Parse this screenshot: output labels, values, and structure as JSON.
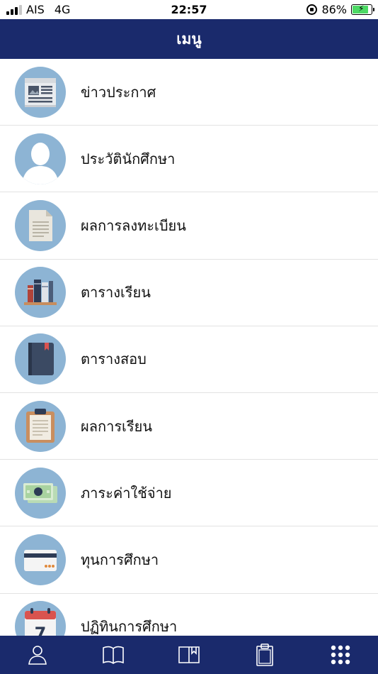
{
  "status_bar": {
    "carrier": "AIS",
    "network": "4G",
    "time": "22:57",
    "battery": "86%",
    "battery_level": 0.86
  },
  "header": {
    "title": "เมนู"
  },
  "menu": {
    "items": [
      {
        "label": "ข่าวประกาศ",
        "icon": "newspaper-icon"
      },
      {
        "label": "ประวัตินักศึกษา",
        "icon": "profile-icon"
      },
      {
        "label": "ผลการลงทะเบียน",
        "icon": "document-icon"
      },
      {
        "label": "ตารางเรียน",
        "icon": "books-icon"
      },
      {
        "label": "ตารางสอบ",
        "icon": "notebook-icon"
      },
      {
        "label": "ผลการเรียน",
        "icon": "clipboard-icon"
      },
      {
        "label": "ภาระค่าใช้จ่าย",
        "icon": "money-icon"
      },
      {
        "label": "ทุนการศึกษา",
        "icon": "card-icon"
      },
      {
        "label": "ปฏิทินการศึกษา",
        "icon": "calendar-icon"
      }
    ],
    "calendar_day": "7"
  },
  "tab_bar": {
    "tabs": [
      {
        "icon": "person-icon"
      },
      {
        "icon": "book-open-icon"
      },
      {
        "icon": "bookmark-book-icon"
      },
      {
        "icon": "clipboard-tab-icon"
      },
      {
        "icon": "grid-icon",
        "active": true
      }
    ]
  },
  "colors": {
    "header_bg": "#1a2a6c",
    "icon_circle": "#8db4d4",
    "divider": "#e2e2e2"
  }
}
